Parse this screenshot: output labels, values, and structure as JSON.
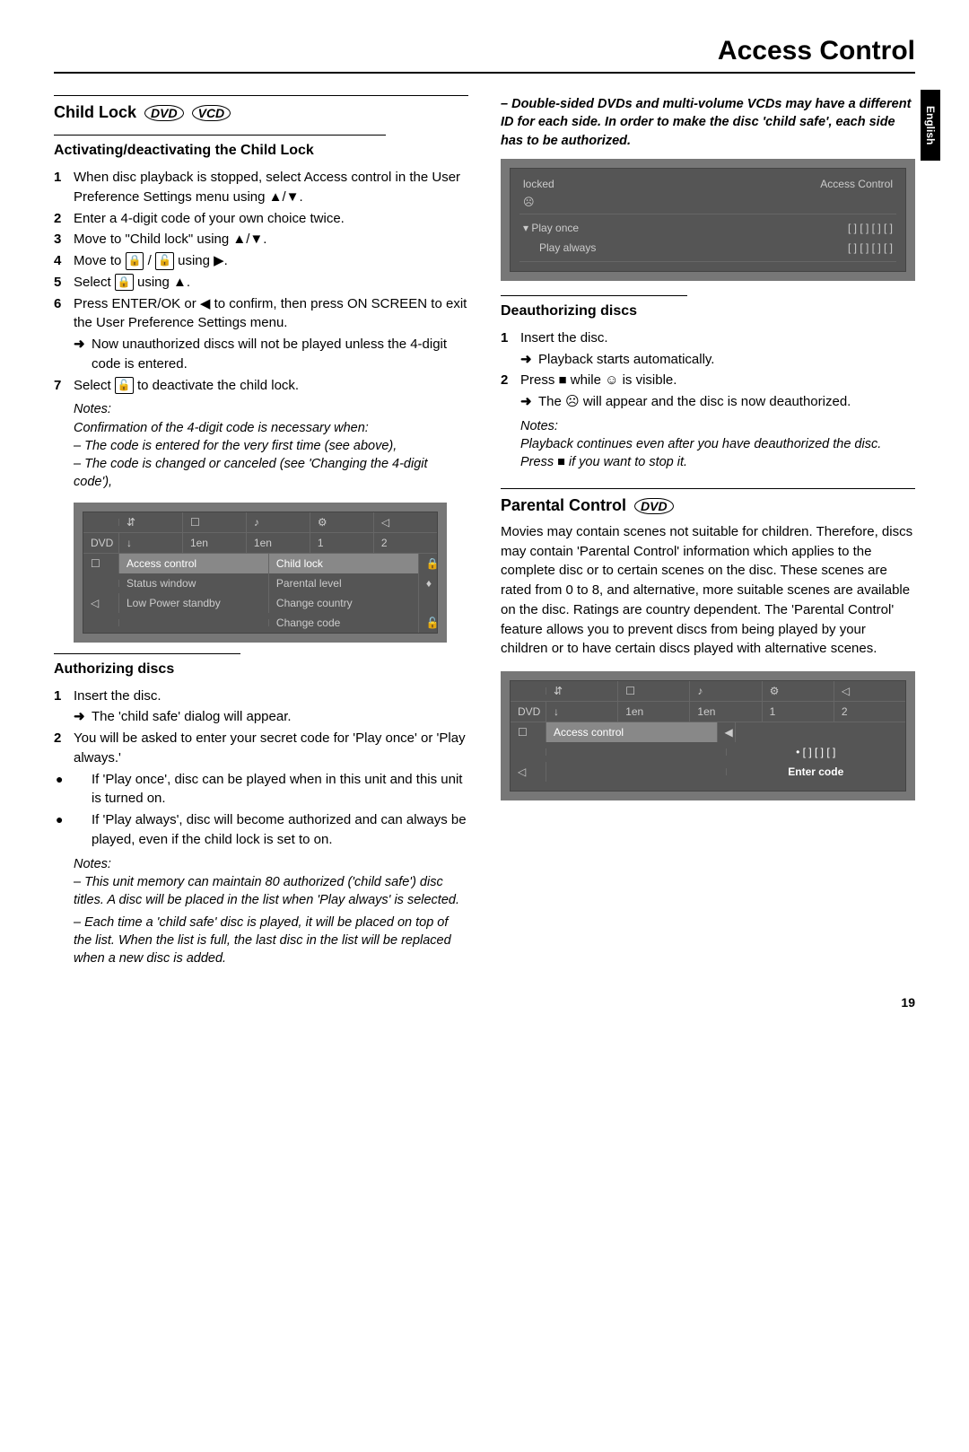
{
  "page_title": "Access Control",
  "language_tab": "English",
  "page_number": "19",
  "col1": {
    "h_childlock": "Child Lock",
    "disc_dvd": "DVD",
    "disc_vcd": "VCD",
    "h_activating": "Activating/deactivating the Child Lock",
    "s1n": "1",
    "s1": "When disc playback is stopped, select Access control in the User Preference Settings menu using ▲/▼.",
    "s2n": "2",
    "s2": "Enter a 4-digit code of your own choice twice.",
    "s3n": "3",
    "s3": "Move to \"Child lock\" using ▲/▼.",
    "s4n": "4",
    "s4a": "Move to ",
    "s4b": " / ",
    "s4c": " using ▶.",
    "s5n": "5",
    "s5a": "Select ",
    "s5b": " using ▲.",
    "s6n": "6",
    "s6": "Press ENTER/OK or ◀ to confirm, then press ON SCREEN to exit the User Preference Settings menu.",
    "s6arrow": "Now unauthorized discs will not be played unless the 4-digit code is entered.",
    "s7n": "7",
    "s7a": "Select ",
    "s7b": " to deactivate the child lock.",
    "notes1_h": "Notes:",
    "notes1_a": "Confirmation of the 4-digit code is necessary when:",
    "notes1_b": "– The code is entered for the very first time (see above),",
    "notes1_c": "– The code is changed or canceled (see 'Changing the 4-digit code'),",
    "osd1": {
      "dvd": "DVD",
      "topicons": [
        "⇵",
        "☐",
        "♪",
        "⚙",
        "◁"
      ],
      "topvals": [
        "1en",
        "1en",
        "1",
        "2"
      ],
      "left": [
        "Access control",
        "Status window",
        "Low Power standby"
      ],
      "right": [
        "Child lock",
        "Parental level",
        "Change country",
        "Change code"
      ]
    },
    "h_authorizing": "Authorizing discs",
    "a1n": "1",
    "a1": "Insert the disc.",
    "a1arrow": "The 'child safe' dialog will appear.",
    "a2n": "2",
    "a2": "You will be asked to enter your secret code for 'Play once' or 'Play always.'",
    "b1": "If 'Play once', disc can be played when in this unit and this unit is turned on.",
    "b2": "If 'Play always', disc will become authorized and can always be played, even if the child lock is set to on.",
    "notes2_h": "Notes:",
    "notes2_a": "– This unit memory can maintain 80 authorized ('child safe') disc titles. A disc will be placed in the list when 'Play always' is selected.",
    "notes2_b": "– Each time a 'child safe' disc is played, it will be placed on top of the list. When the list is full, the last disc in the list will be replaced when a new disc is added."
  },
  "col2": {
    "top_note": "– Double-sided DVDs and multi-volume VCDs may have a different ID for each side. In order to make the disc 'child safe', each side has to be authorized.",
    "osd_lock": {
      "locked": "locked",
      "title": "Access Control",
      "play_once": "▾  Play once",
      "play_always": "Play always",
      "slots": "[ ]  [ ]  [ ]  [ ]"
    },
    "h_deauth": "Deauthorizing discs",
    "d1n": "1",
    "d1": "Insert the disc.",
    "d1arrow": "Playback starts automatically.",
    "d2n": "2",
    "d2": "Press ■ while ☺ is visible.",
    "d2arrow": "The ☹ will appear and the disc is now deauthorized.",
    "notes3_h": "Notes:",
    "notes3_a": "Playback continues even after you have deauthorized the disc. Press ■ if you want to stop it.",
    "h_parental": "Parental Control",
    "parental_body": "Movies may contain scenes not suitable for children. Therefore, discs may contain 'Parental Control' information which applies to the complete disc or to certain scenes on the disc. These scenes are rated from 0 to 8, and alternative, more suitable scenes are available on the disc. Ratings are country dependent. The 'Parental Control' feature allows you to prevent discs from being played by your children or to have certain discs played with alternative scenes.",
    "osd2": {
      "dvd": "DVD",
      "topvals": [
        "1en",
        "1en",
        "1",
        "2"
      ],
      "left": "Access control",
      "enter": "Enter code",
      "slots": "•  [ ] [ ] [ ]"
    }
  }
}
